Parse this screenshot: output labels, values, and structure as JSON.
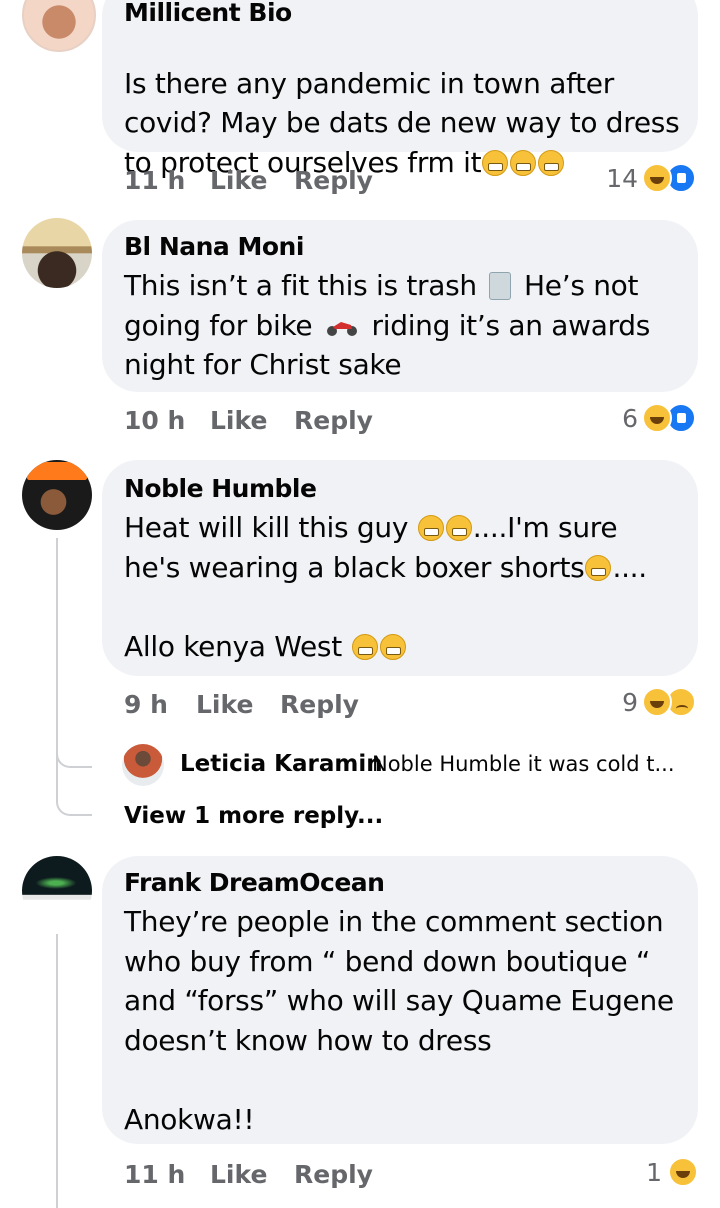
{
  "comments": [
    {
      "author": "Millicent Bio",
      "text": "Is there any pandemic in town after\ncovid? May be dats de new way to dress\nto protect ourselves frm it",
      "emojis": [
        "partying-face-emoji",
        "partying-face-emoji",
        "partying-face-emoji"
      ],
      "time": "11 h",
      "like": "Like",
      "reply": "Reply",
      "reaction_count": "14",
      "reactions": [
        "laugh-reaction",
        "like-reaction"
      ]
    },
    {
      "author": "Bl Nana Moni",
      "text_1": "This isn’t a fit this is trash",
      "text_2": "He’s not",
      "text_3": "going for bike",
      "text_4": "riding it’s an awards",
      "text_5": "night for Christ sake",
      "emojis": [
        "wastebasket-emoji",
        "motorcycle-emoji"
      ],
      "time": "10 h",
      "like": "Like",
      "reply": "Reply",
      "reaction_count": "6",
      "reactions": [
        "laugh-reaction",
        "like-reaction"
      ]
    },
    {
      "author": "Noble Humble",
      "line_1": "Heat will kill this guy",
      "line_1_tail": "....I'm sure",
      "line_2": "he's wearing a black boxer shorts",
      "line_2_tail": "....",
      "line_3": "Allo kenya West",
      "emojis": [
        "grinning-emoji",
        "tears-of-joy-emoji"
      ],
      "time": "9 h",
      "like": "Like",
      "reply": "Reply",
      "reaction_count": "9",
      "reactions": [
        "laugh-reaction",
        "sad-reaction"
      ],
      "reply_preview": {
        "author": "Leticia Karamin",
        "text": "Noble Humble it was cold t..."
      },
      "view_more": "View 1 more reply..."
    },
    {
      "author": "Frank DreamOcean",
      "text": "They’re people in the comment section\nwho buy from “ bend down boutique “\nand “forss” who will say Quame Eugene\ndoesn’t know how to dress\n\nAnokwa!!",
      "time": "11 h",
      "like": "Like",
      "reply": "Reply",
      "reaction_count": "1",
      "reactions": [
        "laugh-reaction"
      ]
    }
  ]
}
